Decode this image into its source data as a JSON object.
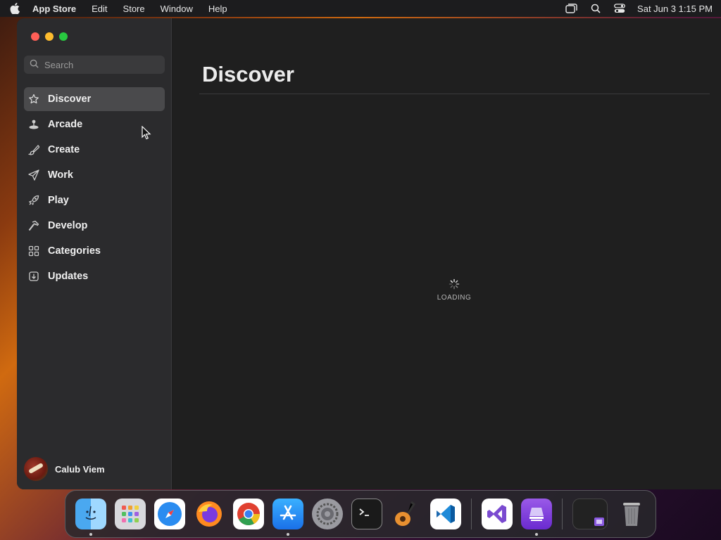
{
  "menubar": {
    "apple_icon": "apple-icon",
    "app_name": "App Store",
    "items": [
      "Edit",
      "Store",
      "Window",
      "Help"
    ],
    "clock": "Sat Jun 3  1:15 PM"
  },
  "sidebar": {
    "search_placeholder": "Search",
    "items": [
      {
        "label": "Discover",
        "icon": "star-icon",
        "active": true
      },
      {
        "label": "Arcade",
        "icon": "joystick-icon"
      },
      {
        "label": "Create",
        "icon": "brush-icon"
      },
      {
        "label": "Work",
        "icon": "paper-plane-icon"
      },
      {
        "label": "Play",
        "icon": "rocket-icon"
      },
      {
        "label": "Develop",
        "icon": "hammer-icon"
      },
      {
        "label": "Categories",
        "icon": "grid-icon"
      },
      {
        "label": "Updates",
        "icon": "download-icon"
      }
    ],
    "user_name": "Calub Viem"
  },
  "main": {
    "title": "Discover",
    "loading_text": "LOADING"
  },
  "dock": {
    "apps": [
      "Finder",
      "Launchpad",
      "Safari",
      "Firefox",
      "Chrome",
      "App Store",
      "System Settings",
      "Terminal",
      "GarageBand",
      "Visual Studio Code",
      "Visual Studio",
      "Apple Configurator",
      "Screen Recording",
      "Trash"
    ]
  },
  "colors": {
    "accent_active": "#4a4a4c",
    "close": "#ff5f57",
    "minimize": "#febc2e",
    "maximize": "#28c840"
  }
}
